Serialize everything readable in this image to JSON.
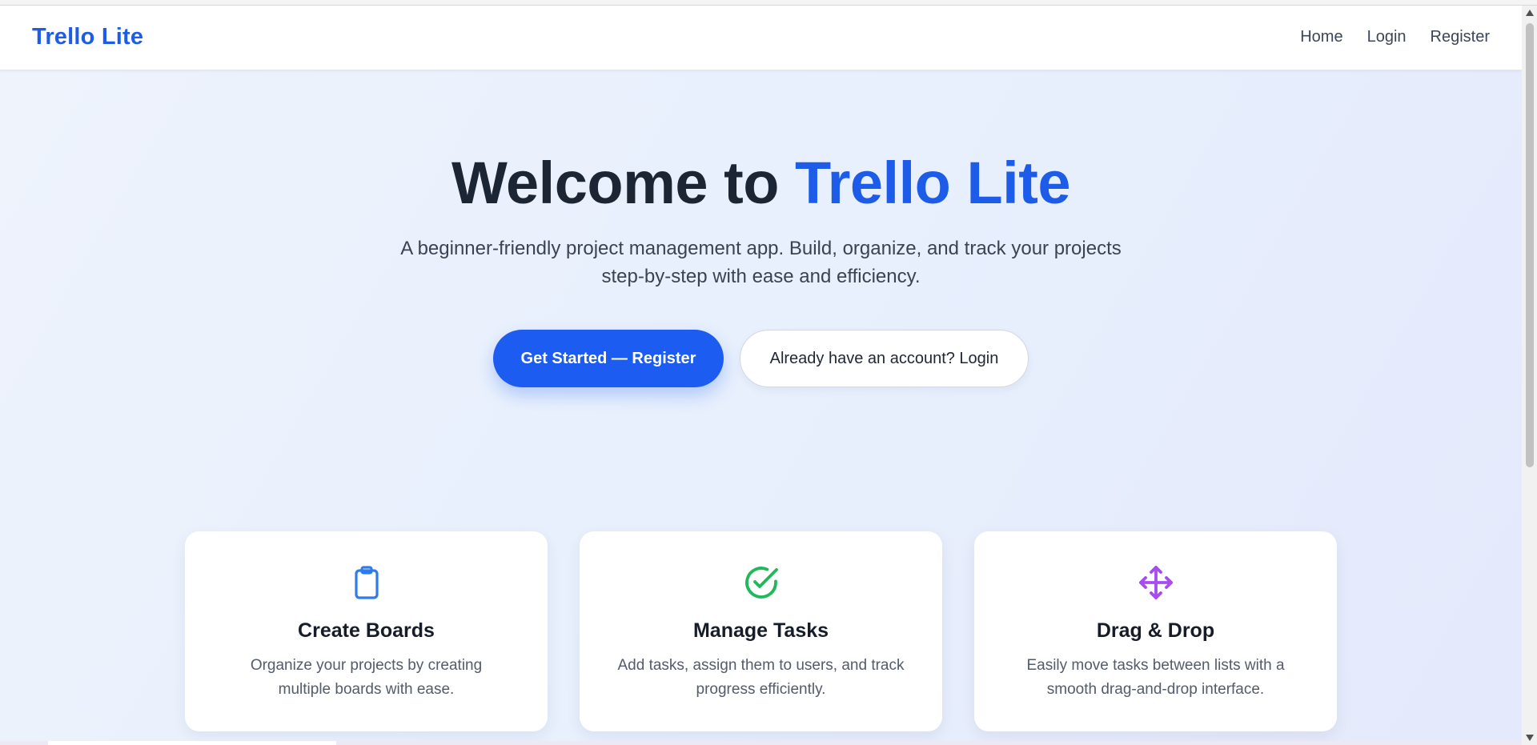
{
  "navbar": {
    "brand": "Trello Lite",
    "links": [
      "Home",
      "Login",
      "Register"
    ]
  },
  "hero": {
    "title_prefix": "Welcome to ",
    "title_accent": "Trello Lite",
    "subtitle_line1": "A beginner-friendly project management app. Build, organize, and track your projects",
    "subtitle_line2": "step-by-step with ease and efficiency.",
    "primary_button": "Get Started — Register",
    "secondary_button": "Already have an account? Login"
  },
  "features": [
    {
      "icon": "clipboard-icon",
      "title": "Create Boards",
      "desc_line1": "Organize your projects by creating",
      "desc_line2": "multiple boards with ease."
    },
    {
      "icon": "check-circle-icon",
      "title": "Manage Tasks",
      "desc_line1": "Add tasks, assign them to users, and track",
      "desc_line2": "progress efficiently."
    },
    {
      "icon": "move-arrows-icon",
      "title": "Drag & Drop",
      "desc_line1": "Easily move tasks between lists with a",
      "desc_line2": "smooth drag-and-drop interface."
    }
  ],
  "colors": {
    "brand": "#1d5ce8",
    "primary_button": "#1d5cf0",
    "heading": "#1c2534",
    "clipboard_icon": "#2f7be8",
    "check_icon": "#1fb85a",
    "move_icon": "#a64cf0"
  }
}
